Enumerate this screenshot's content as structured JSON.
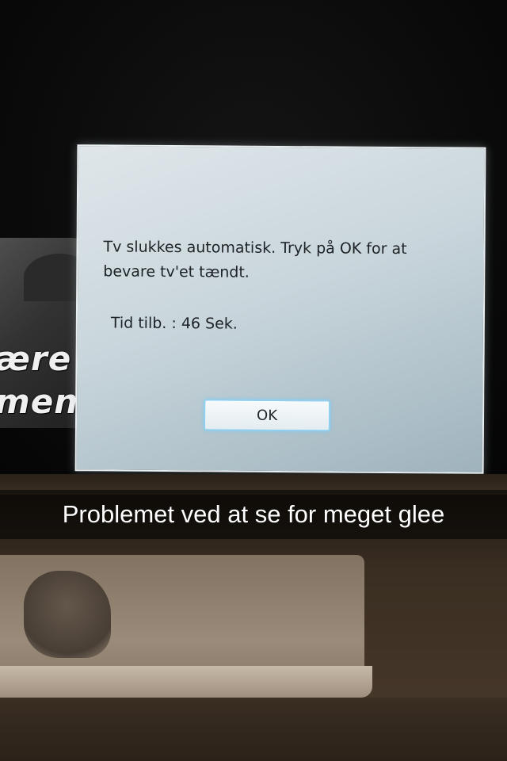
{
  "tv": {
    "subtitles": [
      "ære",
      "meni"
    ],
    "dialog": {
      "message": "Tv slukkes automatisk. Tryk på OK for at bevare tv'et tændt.",
      "timer": "Tid tilb. : 46 Sek.",
      "ok_label": "OK"
    }
  },
  "caption": {
    "text": "Problemet ved at se for meget glee"
  },
  "colors": {
    "dialog_background": "#c9d6dc",
    "ok_button_border": "#8fd0f2",
    "caption_text": "#ffffff"
  }
}
